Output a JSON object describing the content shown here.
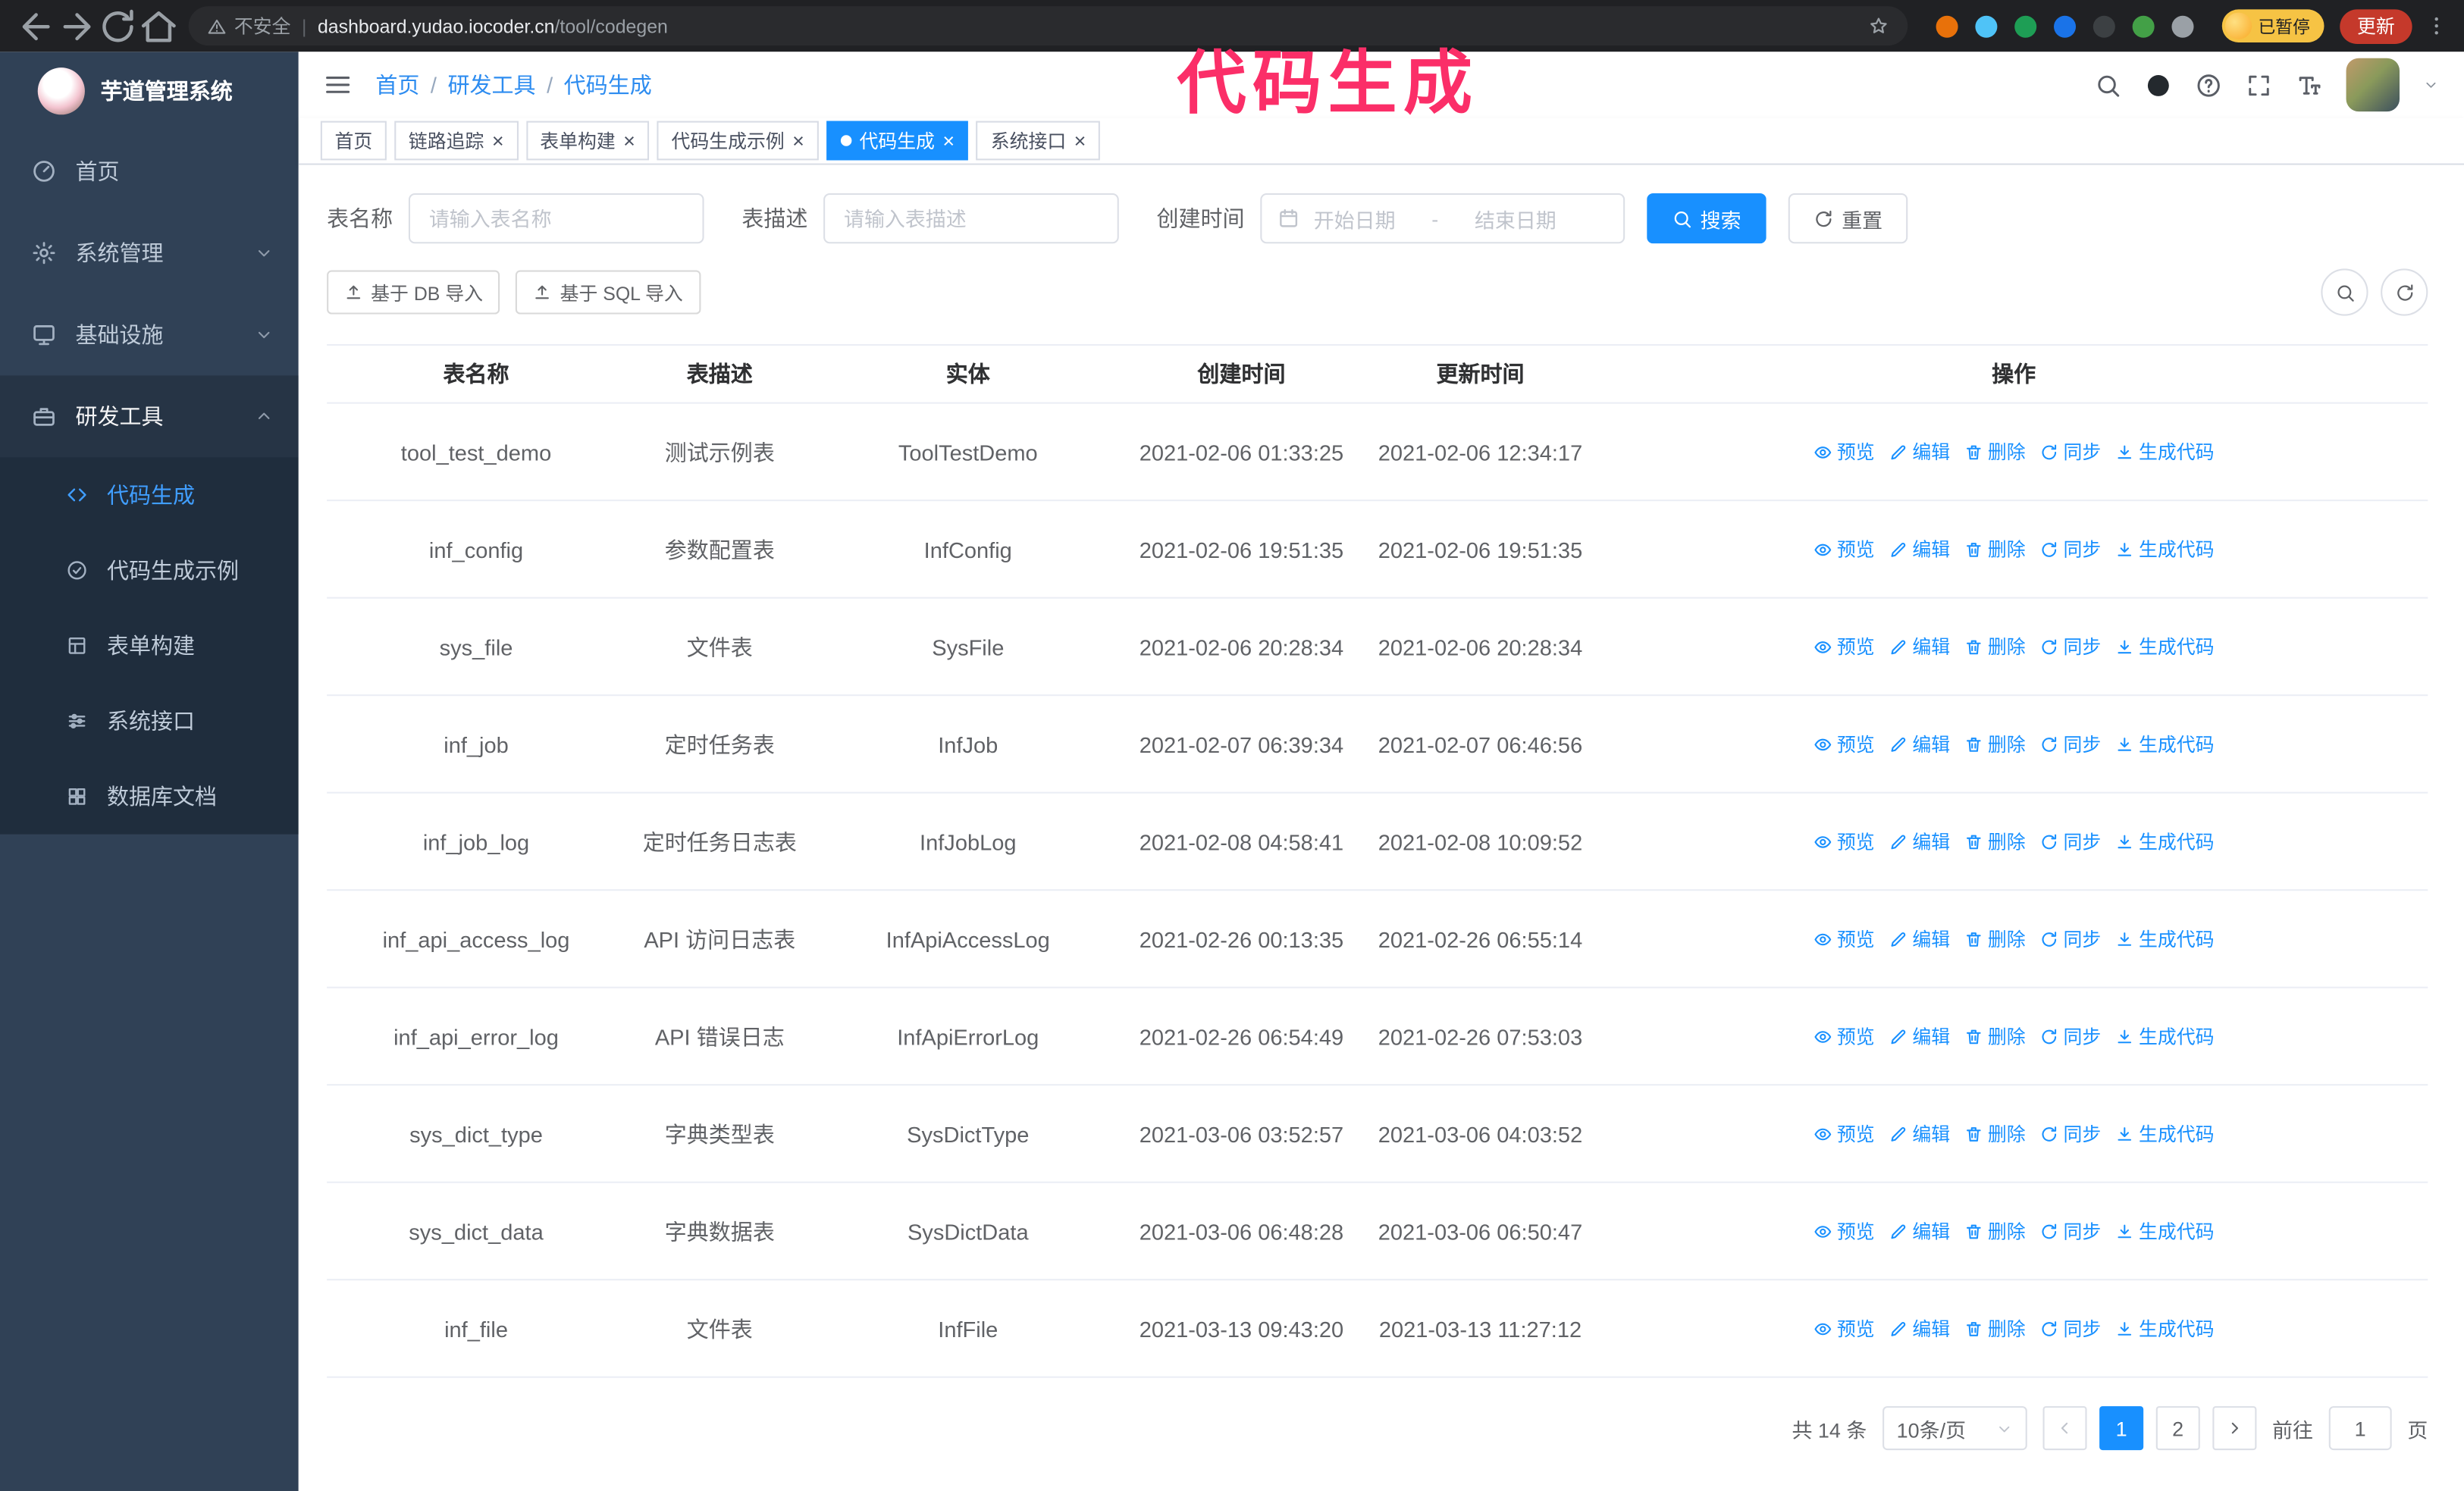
{
  "browser": {
    "security_label": "不安全",
    "url_domain": "dashboard.yudao.iocoder.cn",
    "url_path": "/tool/codegen",
    "paused_badge": "已暂停",
    "update_button": "更新",
    "extensions": [
      {
        "name": "orange-extension-icon",
        "color": "#e8710a"
      },
      {
        "name": "blue-drop-extension-icon",
        "color": "#4fc3f7"
      },
      {
        "name": "green-check-extension-icon",
        "color": "#1e9e55"
      },
      {
        "name": "blue-grid-extension-icon",
        "color": "#1a73e8"
      },
      {
        "name": "dark-extension-icon",
        "color": "#3c4043"
      },
      {
        "name": "leaf-extension-icon",
        "color": "#43a047"
      },
      {
        "name": "puzzle-extension-icon",
        "color": "#9aa0a6"
      }
    ]
  },
  "annotation": {
    "text": "代码生成"
  },
  "sidebar": {
    "logo_title": "芋道管理系统",
    "items": [
      {
        "id": "home",
        "label": "首页",
        "icon": "dashboard"
      },
      {
        "id": "system-manage",
        "label": "系统管理",
        "icon": "gear",
        "expand": "down"
      },
      {
        "id": "infrastructure",
        "label": "基础设施",
        "icon": "monitor",
        "expand": "down"
      },
      {
        "id": "dev-tools",
        "label": "研发工具",
        "icon": "toolbox",
        "expand": "up",
        "active": true
      }
    ],
    "submenu": [
      {
        "id": "codegen",
        "label": "代码生成",
        "icon": "code",
        "active": true
      },
      {
        "id": "codegen-demo",
        "label": "代码生成示例",
        "icon": "badgecheck"
      },
      {
        "id": "form-builder",
        "label": "表单构建",
        "icon": "formgrid"
      },
      {
        "id": "system-api",
        "label": "系统接口",
        "icon": "sliders"
      },
      {
        "id": "db-doc",
        "label": "数据库文档",
        "icon": "dbgrid"
      }
    ]
  },
  "header": {
    "breadcrumb": [
      "首页",
      "研发工具",
      "代码生成"
    ]
  },
  "tabs": [
    {
      "id": "home",
      "label": "首页",
      "closable": false
    },
    {
      "id": "tracer",
      "label": "链路追踪",
      "closable": true
    },
    {
      "id": "form-builder",
      "label": "表单构建",
      "closable": true
    },
    {
      "id": "codegen-demo",
      "label": "代码生成示例",
      "closable": true
    },
    {
      "id": "codegen",
      "label": "代码生成",
      "closable": true,
      "active": true
    },
    {
      "id": "system-api",
      "label": "系统接口",
      "closable": true
    }
  ],
  "filter": {
    "name_label": "表名称",
    "name_placeholder": "请输入表名称",
    "desc_label": "表描述",
    "desc_placeholder": "请输入表描述",
    "time_label": "创建时间",
    "start_placeholder": "开始日期",
    "range_separator": "-",
    "end_placeholder": "结束日期",
    "search_button": "搜索",
    "reset_button": "重置"
  },
  "toolbar": {
    "import_db": "基于 DB 导入",
    "import_sql": "基于 SQL 导入"
  },
  "table": {
    "columns": [
      "表名称",
      "表描述",
      "实体",
      "创建时间",
      "更新时间",
      "操作"
    ],
    "actions": [
      "预览",
      "编辑",
      "删除",
      "同步",
      "生成代码"
    ],
    "rows": [
      {
        "name": "tool_test_demo",
        "desc": "测试示例表",
        "entity": "ToolTestDemo",
        "created": "2021-02-06 01:33:25",
        "updated": "2021-02-06 12:34:17"
      },
      {
        "name": "inf_config",
        "desc": "参数配置表",
        "entity": "InfConfig",
        "created": "2021-02-06 19:51:35",
        "updated": "2021-02-06 19:51:35"
      },
      {
        "name": "sys_file",
        "desc": "文件表",
        "entity": "SysFile",
        "created": "2021-02-06 20:28:34",
        "updated": "2021-02-06 20:28:34"
      },
      {
        "name": "inf_job",
        "desc": "定时任务表",
        "entity": "InfJob",
        "created": "2021-02-07 06:39:34",
        "updated": "2021-02-07 06:46:56"
      },
      {
        "name": "inf_job_log",
        "desc": "定时任务日志表",
        "entity": "InfJobLog",
        "created": "2021-02-08 04:58:41",
        "updated": "2021-02-08 10:09:52"
      },
      {
        "name": "inf_api_access_log",
        "desc": "API 访问日志表",
        "entity": "InfApiAccessLog",
        "created": "2021-02-26 00:13:35",
        "updated": "2021-02-26 06:55:14"
      },
      {
        "name": "inf_api_error_log",
        "desc": "API 错误日志",
        "entity": "InfApiErrorLog",
        "created": "2021-02-26 06:54:49",
        "updated": "2021-02-26 07:53:03"
      },
      {
        "name": "sys_dict_type",
        "desc": "字典类型表",
        "entity": "SysDictType",
        "created": "2021-03-06 03:52:57",
        "updated": "2021-03-06 04:03:52"
      },
      {
        "name": "sys_dict_data",
        "desc": "字典数据表",
        "entity": "SysDictData",
        "created": "2021-03-06 06:48:28",
        "updated": "2021-03-06 06:50:47"
      },
      {
        "name": "inf_file",
        "desc": "文件表",
        "entity": "InfFile",
        "created": "2021-03-13 09:43:20",
        "updated": "2021-03-13 11:27:12"
      }
    ]
  },
  "pagination": {
    "total_text": "共 14 条",
    "page_size": "10条/页",
    "pages": [
      "1",
      "2"
    ],
    "active_page": "1",
    "goto_prefix": "前往",
    "goto_value": "1",
    "goto_suffix": "页"
  },
  "colors": {
    "accent": "#1890ff",
    "sidebar": "#304156",
    "submenu": "#1f2d3d",
    "annotation": "#fb2e68"
  }
}
